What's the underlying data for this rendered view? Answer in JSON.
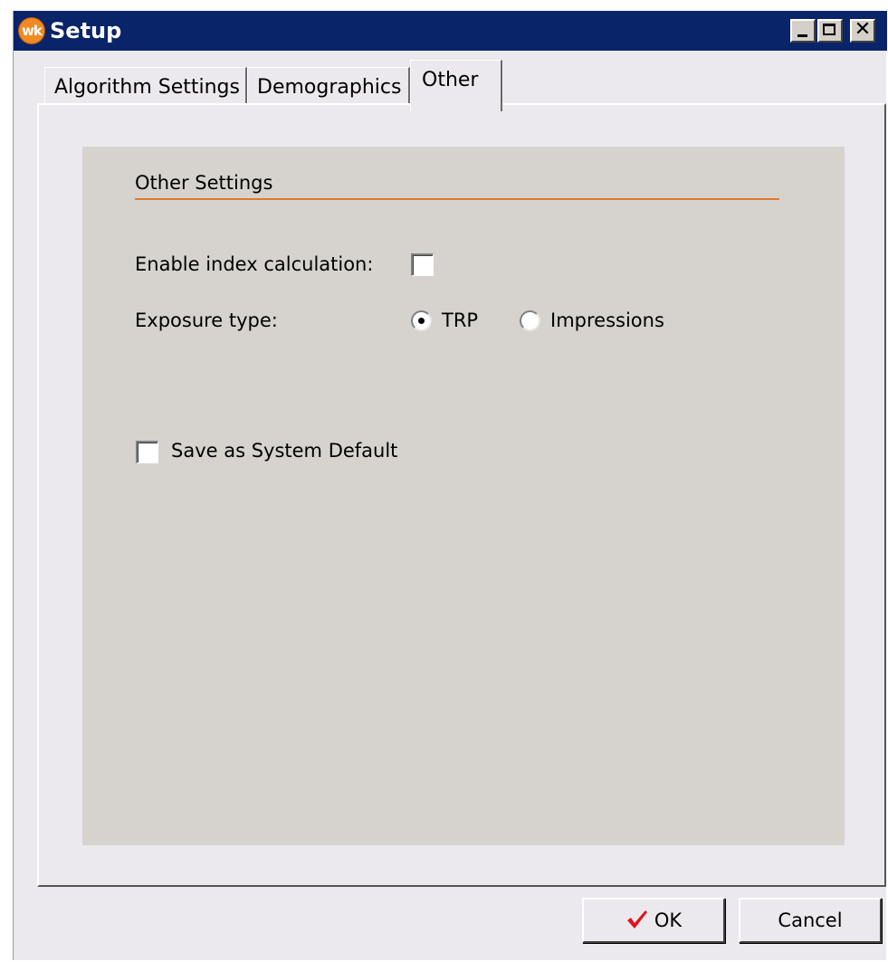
{
  "window": {
    "title": "Setup",
    "app_icon_text": "wk",
    "app_icon_color": "#f08a24",
    "titlebar_color": "#0a246a"
  },
  "tabs": [
    {
      "label": "Algorithm Settings",
      "active": false
    },
    {
      "label": "Demographics",
      "active": false
    },
    {
      "label": "Other",
      "active": true
    }
  ],
  "section": {
    "title": "Other Settings",
    "rule_color": "#e07a2e"
  },
  "fields": {
    "enable_index_label": "Enable index calculation:",
    "enable_index_checked": false,
    "exposure_label": "Exposure type:",
    "exposure_options": [
      {
        "label": "TRP",
        "selected": true
      },
      {
        "label": "Impressions",
        "selected": false
      }
    ],
    "save_default_label": "Save as System Default",
    "save_default_checked": false
  },
  "buttons": {
    "ok_label": "OK",
    "ok_icon": "check-icon",
    "ok_icon_color": "#e0141c",
    "cancel_label": "Cancel"
  }
}
